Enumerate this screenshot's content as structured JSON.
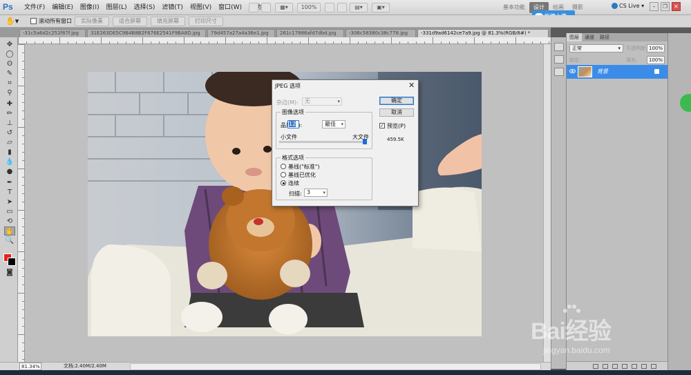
{
  "app": {
    "logo": "Ps"
  },
  "menu": [
    "文件(F)",
    "编辑(E)",
    "图像(I)",
    "图层(L)",
    "选择(S)",
    "滤镜(T)",
    "视图(V)",
    "窗口(W)",
    "帮助(H)"
  ],
  "menubar": {
    "zoom_label": "100%",
    "workspaces": [
      "基本功能",
      "设计",
      "绘画",
      "摄影"
    ],
    "active_workspace": "设计",
    "cs_live": "CS Live",
    "upload_popup": "拖拽上传"
  },
  "options_bar": {
    "scroll_all_label": "滚动所有窗口",
    "buttons": [
      "实际像素",
      "适合屏幕",
      "填充屏幕",
      "打印尺寸"
    ]
  },
  "doc_tabs": [
    "-31c5a6d2c252f87f.jpg",
    "31E263DE5C9B4B8B2F676E2541F9BA8D.jpg",
    "79d457a27a4a36e1.jpg",
    "261c17886afd7dbd.jpg",
    "-306c58380c38c778.jpg",
    "-331d9ad6142ce7a9.jpg @ 81.3%(RGB/8#) *"
  ],
  "statusbar": {
    "zoom": "81.34%",
    "doc_info": "文档:2.40M/2.40M"
  },
  "layers_panel": {
    "tabs": [
      "图层",
      "通道",
      "路径"
    ],
    "blend_mode": "正常",
    "opacity_label": "不透明度:",
    "opacity": "100%",
    "lock_label": "锁定:",
    "fill_label": "填充:",
    "fill": "100%",
    "layer_name": "背景"
  },
  "jpeg_dialog": {
    "title": "JPEG 选项",
    "matte_label": "杂边(M):",
    "matte_value": "无",
    "image_options_legend": "图像选项",
    "quality_label": "品质(Q):",
    "quality_value": "12",
    "quality_preset": "最佳",
    "small_file": "小文件",
    "large_file": "大文件",
    "format_options_legend": "格式选项",
    "format_baseline": "基线(\"标准\")",
    "format_optimized": "基线已优化",
    "format_progressive": "连续",
    "scans_label": "扫描:",
    "scans_value": "3",
    "ok": "确定",
    "cancel": "取消",
    "preview_label": "预览(P)",
    "file_size": "459.5K"
  },
  "watermark": {
    "text": "Bai经验",
    "url": "jingyan.baidu.com"
  },
  "colors": {
    "foreground": "#e8221f",
    "background": "#000000",
    "selection": "#3b8ce8",
    "accent": "#2b73c5"
  }
}
